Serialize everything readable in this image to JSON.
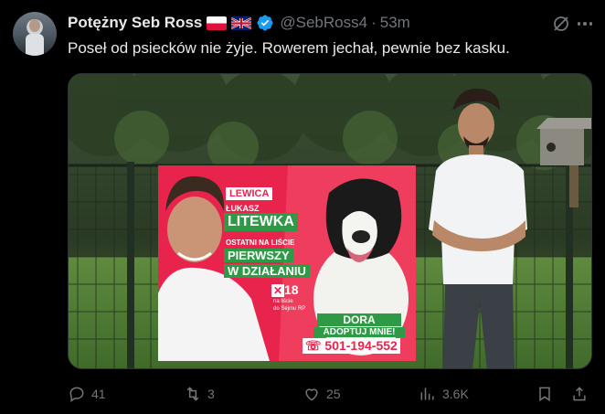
{
  "author": {
    "name": "Potężny Seb Ross",
    "handle": "@SebRoss4",
    "separator": "·",
    "time": "53m"
  },
  "tweet": {
    "text": "Poseł od psiecków nie żyje. Rowerem jechał, pewnie bez kasku."
  },
  "poster": {
    "party": "LEWICA",
    "first_name": "ŁUKASZ",
    "last_name": "LITEWKA",
    "line1": "OSTATNI NA LIŚCIE",
    "slogan1": "PIERWSZY",
    "slogan2": "W DZIAŁANIU",
    "list_number": "18",
    "list_caption1": "na liście",
    "list_caption2": "do Sejmu RP",
    "dog_name": "DORA",
    "adopt": "ADOPTUJ MNIE!",
    "phone": "501-194-552"
  },
  "actions": {
    "replies": "41",
    "reposts": "3",
    "likes": "25",
    "views": "3.6K"
  },
  "colors": {
    "accent_blue": "#1d9bf0",
    "muted": "#71767b",
    "poster_red": "#e31e44",
    "poster_green": "#2f9a45"
  },
  "icons": [
    "verified-icon",
    "grok-icon",
    "more-icon",
    "reply-icon",
    "repost-icon",
    "like-icon",
    "views-icon",
    "bookmark-icon",
    "share-icon"
  ]
}
